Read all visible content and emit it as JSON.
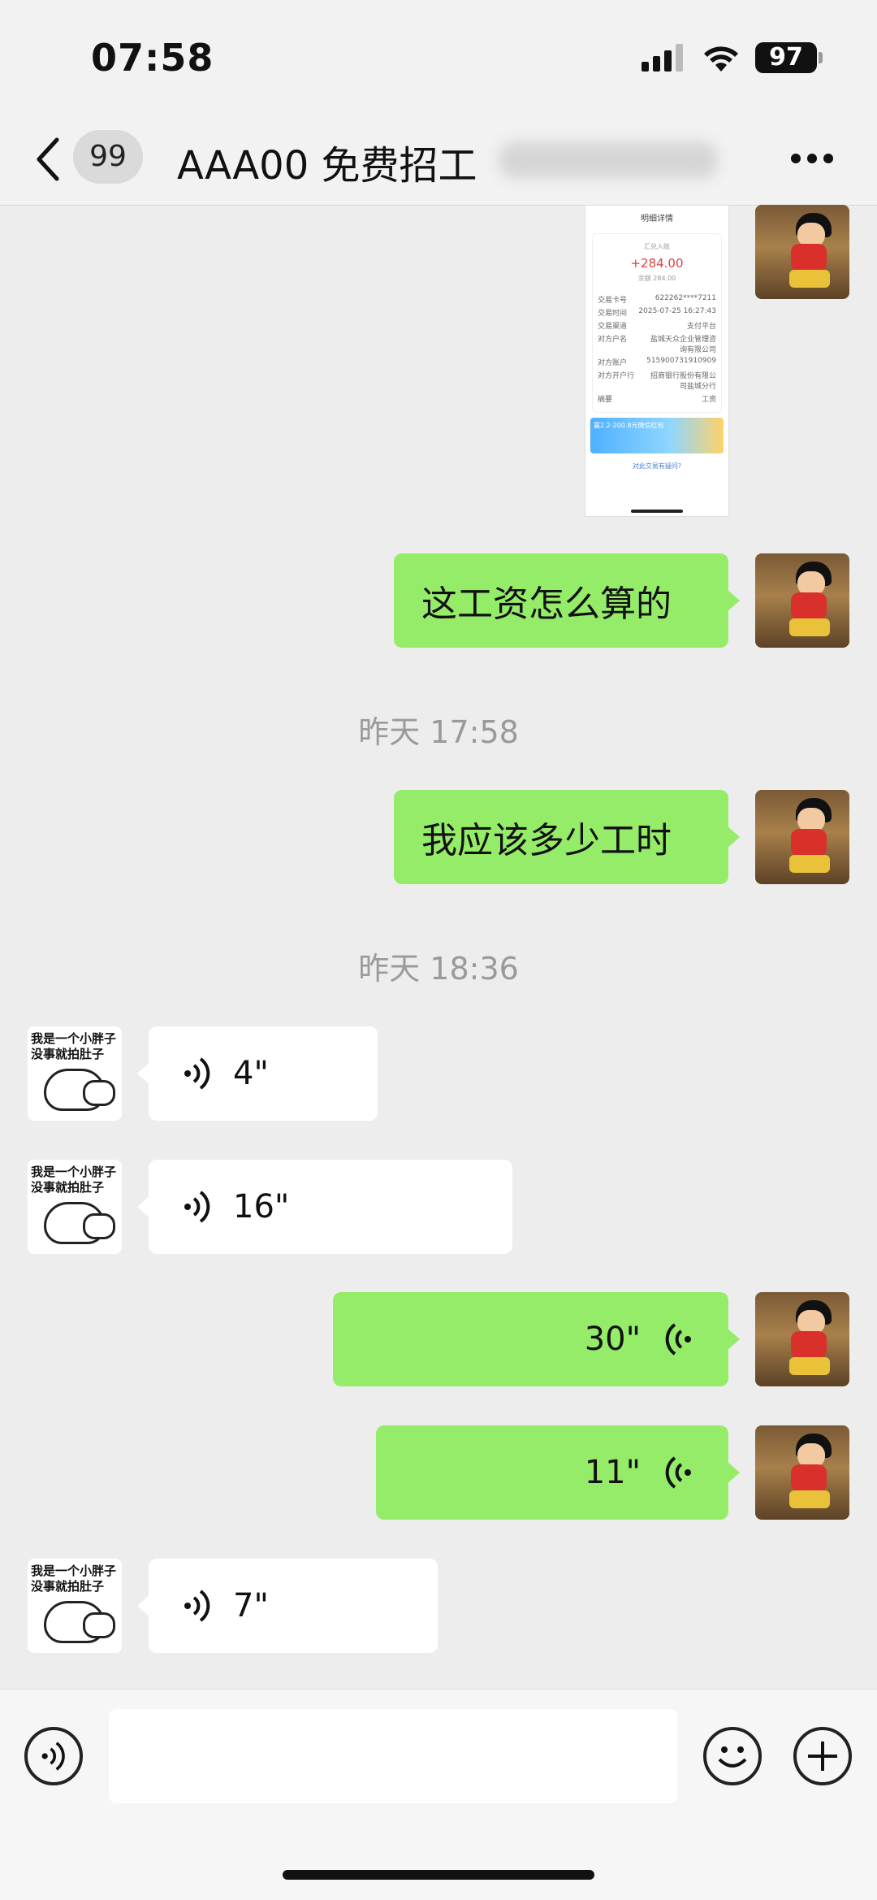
{
  "status_bar": {
    "time": "07:58",
    "battery": "97"
  },
  "nav": {
    "unread_count": "99",
    "title": "AAA00 免费招工"
  },
  "image_message": {
    "header": "明细详情",
    "label": "汇兑入账",
    "amount": "+284.00",
    "balance_label": "余额",
    "balance": "284.00",
    "rows": [
      {
        "k": "交易卡号",
        "v": "622262****7211"
      },
      {
        "k": "交易时间",
        "v": "2025-07-25 16:27:43"
      },
      {
        "k": "交易渠道",
        "v": "支付平台"
      },
      {
        "k": "对方户名",
        "v": "盐城天众企业管理咨询有限公司"
      },
      {
        "k": "对方账户",
        "v": "515900731910909"
      },
      {
        "k": "对方开户行",
        "v": "招商银行股份有限公司盐城分行"
      },
      {
        "k": "摘要",
        "v": "工资"
      }
    ],
    "ad_text": "赢2.2-200.8元微信红包",
    "link": "对此交易有疑问?"
  },
  "messages": [
    {
      "side": "me",
      "text": "这工资怎么算的"
    },
    {
      "type": "timestamp",
      "text": "昨天 17:58"
    },
    {
      "side": "me",
      "text": "我应该多少工时"
    },
    {
      "type": "timestamp",
      "text": "昨天 18:36"
    },
    {
      "side": "other",
      "voice": "4\""
    },
    {
      "side": "other",
      "voice": "16\""
    },
    {
      "side": "me",
      "voice": "30\""
    },
    {
      "side": "me",
      "voice": "11\""
    },
    {
      "side": "other",
      "voice": "7\""
    }
  ],
  "other_avatar_caption": "我是一个小胖子 没事就拍肚子",
  "icons": [
    "back-chevron-icon",
    "more-icon",
    "voice-icon",
    "emoji-icon",
    "plus-icon"
  ]
}
